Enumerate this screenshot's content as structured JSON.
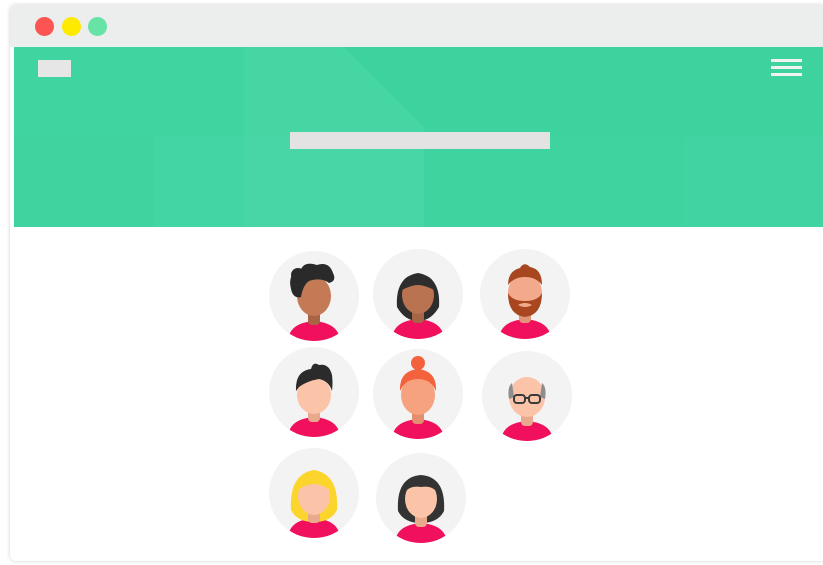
{
  "window": {
    "controls": [
      {
        "name": "close",
        "color": "#fb5452"
      },
      {
        "name": "minimize",
        "color": "#fdea00"
      },
      {
        "name": "zoom",
        "color": "#66e3a5"
      }
    ]
  },
  "header": {
    "background_color": "#3dd29e",
    "logo": "placeholder-block",
    "menu_icon": "hamburger-menu-icon",
    "title": "placeholder-bar"
  },
  "avatars": {
    "shirt_color": "#f0105d",
    "circle_color": "#f3f3f3",
    "items": [
      {
        "icon": "avatar-curly-hair-man",
        "skin": "#c47a55",
        "hair": "#2a2a2a"
      },
      {
        "icon": "avatar-bob-hair-woman",
        "skin": "#b97350",
        "hair": "#2d2d2d"
      },
      {
        "icon": "avatar-bearded-man",
        "skin": "#f2a98c",
        "hair": "#a8471f"
      },
      {
        "icon": "avatar-spiky-hair-man",
        "skin": "#fbc3a8",
        "hair": "#2b2b2b"
      },
      {
        "icon": "avatar-redhead-bun-woman",
        "skin": "#f7a27f",
        "hair": "#f4613d"
      },
      {
        "icon": "avatar-bald-man-glasses",
        "skin": "#fbc3a8",
        "hair": "#8d8d8d"
      },
      {
        "icon": "avatar-blonde-woman",
        "skin": "#fbc3a8",
        "hair": "#fcd52c"
      },
      {
        "icon": "avatar-dark-hair-woman",
        "skin": "#fbc3a8",
        "hair": "#333333"
      }
    ]
  }
}
